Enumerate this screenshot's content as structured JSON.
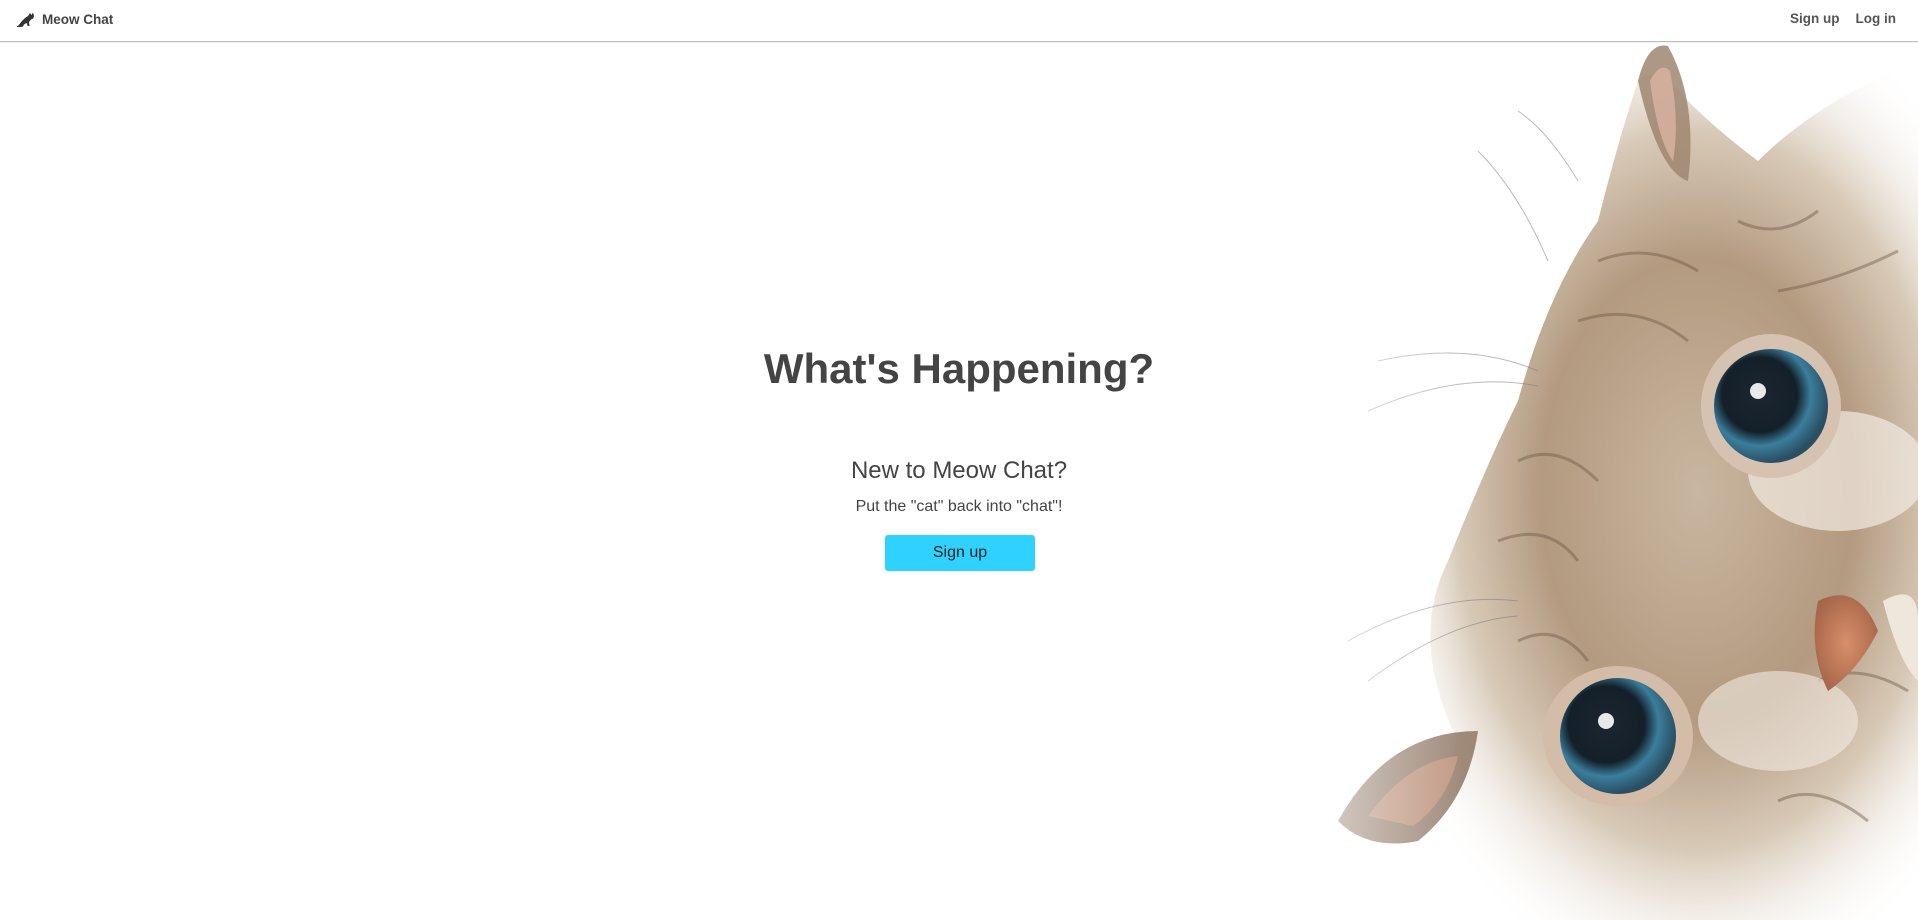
{
  "navbar": {
    "brand_name": "Meow Chat",
    "brand_icon": "cat-silhouette-icon",
    "signup_label": "Sign up",
    "login_label": "Log in"
  },
  "hero": {
    "title": "What's Happening?",
    "subtitle": "New to Meow Chat?",
    "tagline": "Put the \"cat\" back into \"chat\"!",
    "cta_label": "Sign up"
  },
  "background_image": "kitten-face-illustration",
  "colors": {
    "accent": "#2fd1ff",
    "text": "#444444",
    "navbar_border": "#bdbdbd"
  }
}
